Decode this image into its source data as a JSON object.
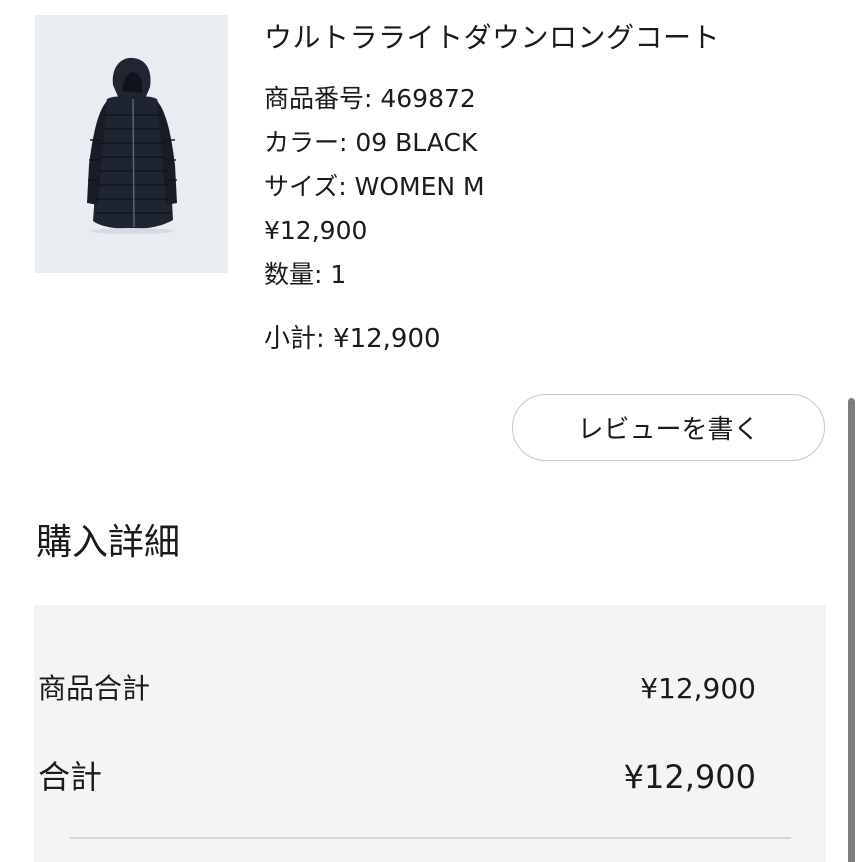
{
  "product": {
    "name": "ウルトラライトダウンロングコート",
    "item_number": "商品番号: 469872",
    "color": "カラー: 09 BLACK",
    "size": "サイズ: WOMEN M",
    "price": "¥12,900",
    "quantity": "数量: 1",
    "subtotal": "小計: ¥12,900",
    "image_icon": "long-down-coat-image"
  },
  "review_button": {
    "label": "レビューを書く"
  },
  "purchase_details": {
    "title": "購入詳細",
    "rows": [
      {
        "label": "商品合計",
        "value": "¥12,900"
      },
      {
        "label": "合計",
        "value": "¥12,900"
      }
    ]
  },
  "colors": {
    "image_background": "#e9ecf0",
    "coat": "#1e2430",
    "panel_background": "#f4f4f4",
    "button_border": "#c9c9c9",
    "text": "#1b1b1b"
  }
}
